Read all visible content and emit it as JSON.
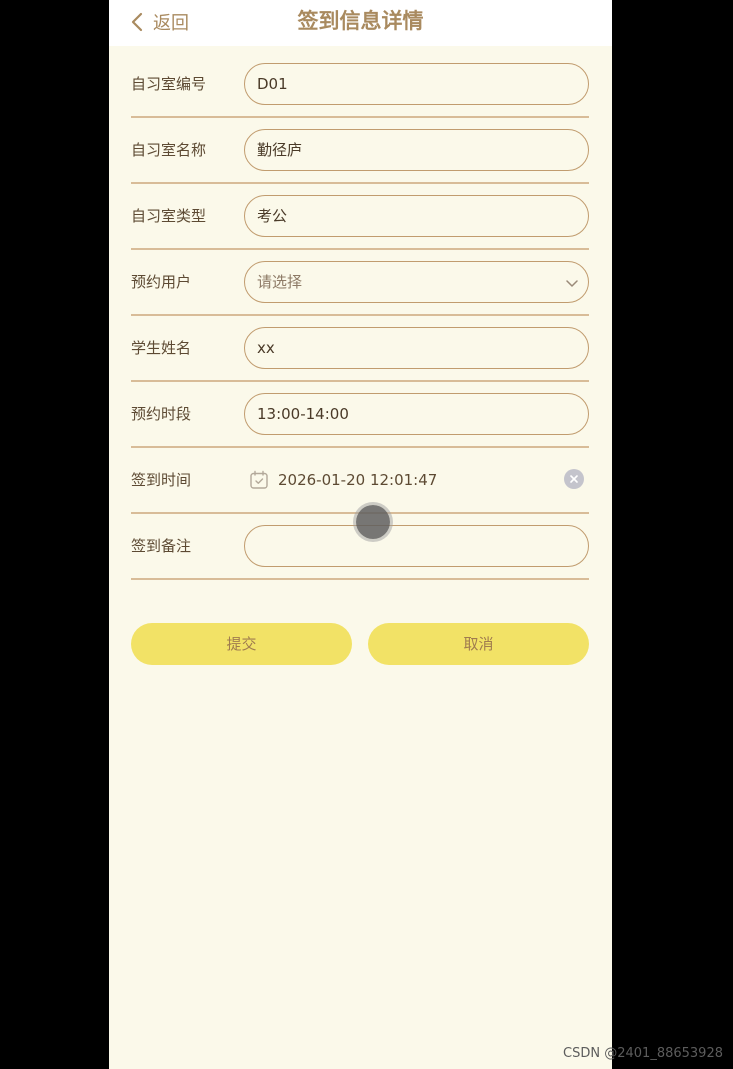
{
  "header": {
    "back_label": "返回",
    "title": "签到信息详情"
  },
  "form": {
    "rows": [
      {
        "label": "自习室编号",
        "value": "D01"
      },
      {
        "label": "自习室名称",
        "value": "勤径庐"
      },
      {
        "label": "自习室类型",
        "value": "考公"
      },
      {
        "label": "预约用户",
        "placeholder": "请选择"
      },
      {
        "label": "学生姓名",
        "value": "xx"
      },
      {
        "label": "预约时段",
        "value": "13:00-14:00"
      },
      {
        "label": "签到时间",
        "value": "2026-01-20 12:01:47"
      },
      {
        "label": "签到备注",
        "value": ""
      }
    ]
  },
  "actions": {
    "submit_label": "提交",
    "cancel_label": "取消"
  },
  "watermark": "CSDN @2401_88653928",
  "colors": {
    "accent": "#a98a5f",
    "button": "#f2e266",
    "background": "#fbf9ea",
    "border": "#c19c6f"
  },
  "icons": {
    "back": "chevron-left-icon",
    "dropdown": "chevron-down-icon",
    "calendar": "calendar-icon",
    "clear": "close-icon"
  }
}
